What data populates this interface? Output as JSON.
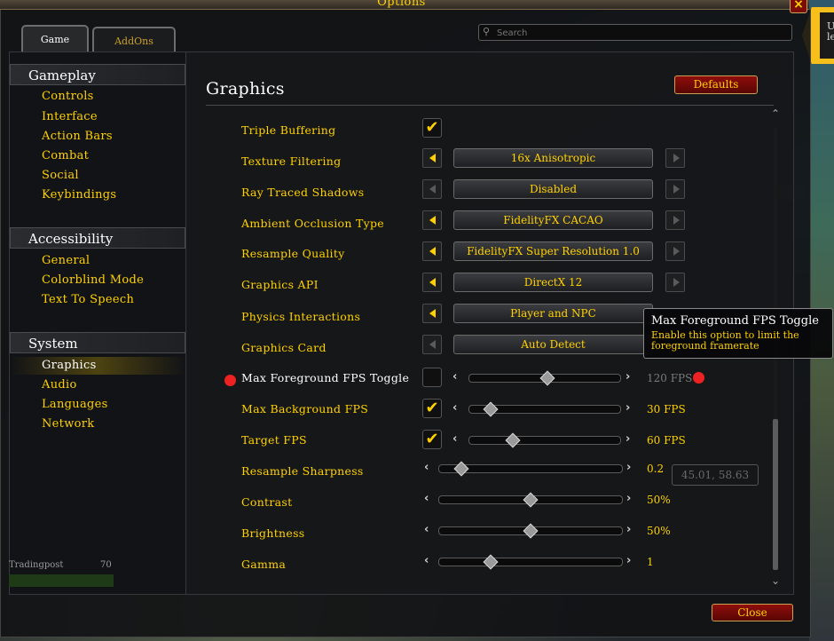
{
  "window": {
    "title": "Options",
    "close_icon": "×"
  },
  "tabs": [
    {
      "label": "Game"
    },
    {
      "label": "AddOns"
    }
  ],
  "search": {
    "placeholder": "Search",
    "value": ""
  },
  "sidebar": {
    "categories": [
      {
        "label": "Gameplay",
        "items": [
          "Controls",
          "Interface",
          "Action Bars",
          "Combat",
          "Social",
          "Keybindings"
        ]
      },
      {
        "label": "Accessibility",
        "items": [
          "General",
          "Colorblind Mode",
          "Text To Speech"
        ]
      },
      {
        "label": "System",
        "items": [
          "Graphics",
          "Audio",
          "Languages",
          "Network"
        ],
        "selected": "Graphics"
      }
    ],
    "profession": {
      "label": "Tradingpost",
      "value": "70"
    }
  },
  "main": {
    "heading": "Graphics",
    "defaults_label": "Defaults",
    "close_label": "Close",
    "coords_readout": "45.01, 58.63"
  },
  "settings": {
    "triple_buffering": {
      "label": "Triple Buffering",
      "checked": true
    },
    "texture_filtering": {
      "label": "Texture Filtering",
      "value": "16x Anisotropic"
    },
    "ray_traced_shadows": {
      "label": "Ray Traced Shadows",
      "value": "Disabled"
    },
    "ambient_occlusion": {
      "label": "Ambient Occlusion Type",
      "value": "FidelityFX CACAO"
    },
    "resample_quality": {
      "label": "Resample Quality",
      "value": "FidelityFX Super Resolution 1.0"
    },
    "graphics_api": {
      "label": "Graphics API",
      "value": "DirectX 12"
    },
    "physics_interactions": {
      "label": "Physics Interactions",
      "value": "Player and NPC"
    },
    "graphics_card": {
      "label": "Graphics Card",
      "value": "Auto Detect"
    },
    "max_foreground_fps": {
      "label": "Max Foreground FPS Toggle",
      "checked": false,
      "value": "120 FPS",
      "level": 0.52
    },
    "max_background_fps": {
      "label": "Max Background FPS",
      "checked": true,
      "value": "30 FPS",
      "level": 0.14
    },
    "target_fps": {
      "label": "Target FPS",
      "checked": true,
      "value": "60 FPS",
      "level": 0.29
    },
    "resample_sharpness": {
      "label": "Resample Sharpness",
      "value": "0.2",
      "level": 0.12
    },
    "contrast": {
      "label": "Contrast",
      "value": "50%",
      "level": 0.5
    },
    "brightness": {
      "label": "Brightness",
      "value": "50%",
      "level": 0.5
    },
    "gamma": {
      "label": "Gamma",
      "value": "1",
      "level": 0.28
    }
  },
  "tooltip": {
    "title": "Max Foreground FPS Toggle",
    "body": "Enable this option to limit the foreground framerate"
  },
  "colors": {
    "gold": "#ffd100",
    "button_red": "#8f0e0b",
    "marker_red": "#e22222"
  }
}
